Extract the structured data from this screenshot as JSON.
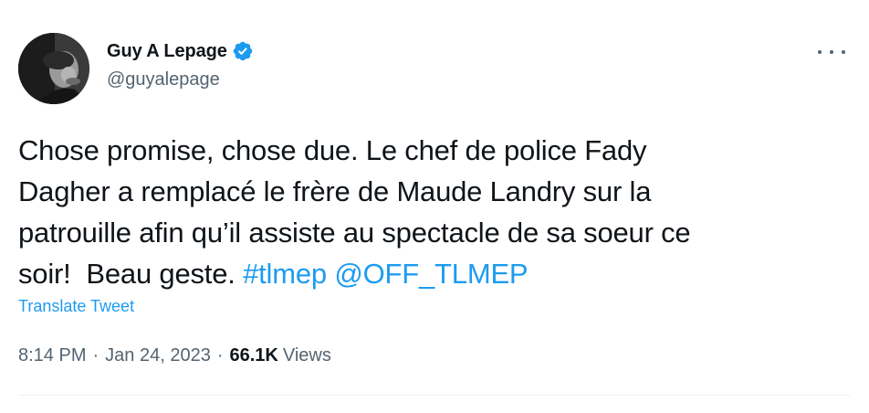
{
  "author": {
    "name": "Guy A Lepage",
    "handle": "@guyalepage",
    "verified": true,
    "avatar_icon": "profile-photo"
  },
  "tweet": {
    "text_lines": [
      "Chose promise, chose due. Le chef de police Fady",
      "Dagher a remplacé le frère de Maude Landry sur la",
      "patrouille afin qu’il assiste au spectacle de sa soeur ce",
      "soir!  Beau geste. "
    ],
    "hashtag": "#tlmep",
    "mention": "@OFF_TLMEP",
    "translate_label": "Translate Tweet"
  },
  "meta": {
    "time": "8:14 PM",
    "separator": "·",
    "date": "Jan 24, 2023",
    "views_count": "66.1K",
    "views_label": "Views"
  },
  "icons": {
    "more": "more-horizontal-icon",
    "verified": "verified-badge-icon"
  },
  "colors": {
    "link": "#1d9bf0",
    "secondary_text": "#536471",
    "primary_text": "#0f1419",
    "verified_badge": "#1d9bf0"
  }
}
